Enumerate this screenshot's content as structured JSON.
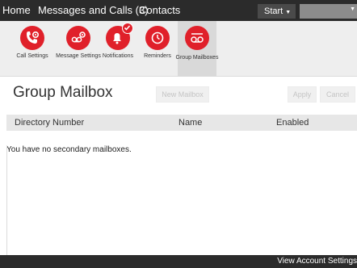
{
  "nav": {
    "home": "Home",
    "messages_calls": "Messages and Calls (3)",
    "contacts": "Contacts",
    "start": "Start",
    "account_value": ""
  },
  "tiles": [
    {
      "label": "Call Settings",
      "icon": "phone-gear-icon"
    },
    {
      "label": "Message Settings",
      "icon": "voicemail-gear-icon"
    },
    {
      "label": "Notifications",
      "icon": "bell-check-icon"
    },
    {
      "label": "Reminders",
      "icon": "clock-icon"
    },
    {
      "label": "Group Mailboxes",
      "icon": "voicemail-icon"
    }
  ],
  "page": {
    "title": "Group Mailbox",
    "new_mailbox": "New Mailbox",
    "apply": "Apply",
    "cancel": "Cancel"
  },
  "table": {
    "columns": [
      "Directory Number",
      "Name",
      "Enabled"
    ],
    "empty_message": "You have no secondary mailboxes."
  },
  "footer": {
    "link": "View Account Settings"
  },
  "colors": {
    "accent": "#e0202a",
    "topbar": "#2b2b2b"
  }
}
